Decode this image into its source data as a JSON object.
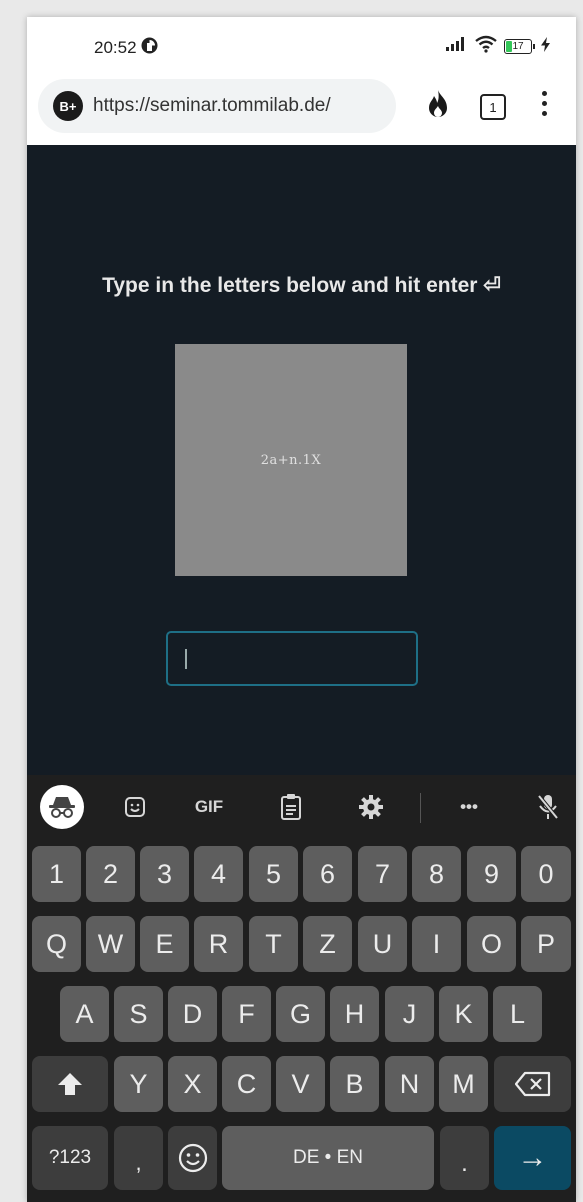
{
  "status_bar": {
    "time": "20:52",
    "battery": "17"
  },
  "browser": {
    "site_badge": "B+",
    "url": "https://seminar.tommilab.de/",
    "tab_count": "1"
  },
  "page": {
    "instruction": "Type in the letters below and hit enter ⏎",
    "captcha_text": "2a+n.1X",
    "input_value": ""
  },
  "keyboard": {
    "toolbar": {
      "gif_label": "GIF",
      "more_label": "•••"
    },
    "row_numbers": [
      "1",
      "2",
      "3",
      "4",
      "5",
      "6",
      "7",
      "8",
      "9",
      "0"
    ],
    "row_qwerty": [
      "Q",
      "W",
      "E",
      "R",
      "T",
      "Z",
      "U",
      "I",
      "O",
      "P"
    ],
    "row_asdf": [
      "A",
      "S",
      "D",
      "F",
      "G",
      "H",
      "J",
      "K",
      "L"
    ],
    "row_yxcv": [
      "Y",
      "X",
      "C",
      "V",
      "B",
      "N",
      "M"
    ],
    "symbols_label": "?123",
    "comma_label": ",",
    "space_label": "DE • EN",
    "period_label": ".",
    "enter_label": "→"
  }
}
